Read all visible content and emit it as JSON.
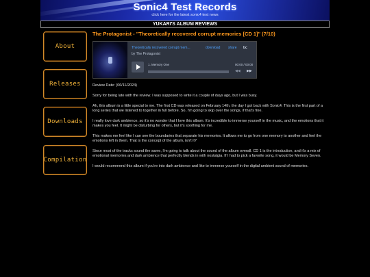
{
  "banner": {
    "title": "Sonic4 Test Records",
    "subtitle": "click here for the latest sonic4 test news"
  },
  "section_title": "YUKARI'S ALBUM REVIEWS",
  "nav": {
    "about": "About",
    "releases": "Releases",
    "downloads": "Downloads",
    "compilation": "Compilation"
  },
  "review": {
    "heading": "The Protagonist - \"Theoretically recovered corrupt memories [CD 1]\" (7/10)",
    "date": "Review Date: (06/11/2024)",
    "paragraphs": [
      "Sorry for being late with the review. I was supposed to write it a couple of days ago, but I was busy.",
      "Ah, this album is a little special to me. The first CD was released on February 14th, the day I got back with Sonic4. This is the first part of a long series that we listened to together in full before. So, I'm going to skip over the songs, if that's fine.",
      "I really love dark ambience, so it's no wonder that I love this album. It's incredible to immerse yourself in the music, and the emotions that it makes you feel. It might be disturbing for others, but it's soothing for me.",
      "This makes me feel like I can see the boundaries that separate his memories. It allows me to go from one memory to another and feel the emotions left in them. That is the concept of the album, isn't it?",
      "Since most of the tracks sound the same, I'm going to talk about the sound of the album overall. CD 1 is the introduction, and it's a mix of emotional memories and dark ambience that perfectly blends in with nostalgia. If I had to pick a favorite song, it would be Memory Seven.",
      "I would recommend this album if you're into dark ambience and like to immerse yourself in the digital ambient sound of memories."
    ]
  },
  "player": {
    "title": "Theoretically recovered corrupt mem...",
    "download": "download",
    "share": "share",
    "brand": "bc",
    "artist": "by The Protagonist",
    "track": "1. Memory One",
    "time": "00:00 / 00:00",
    "progress": 0
  },
  "colors": {
    "accent": "#ff9a1f",
    "nav_border": "#d28a2a",
    "nav_text": "#f2b33a",
    "link": "#4fa3ff"
  }
}
